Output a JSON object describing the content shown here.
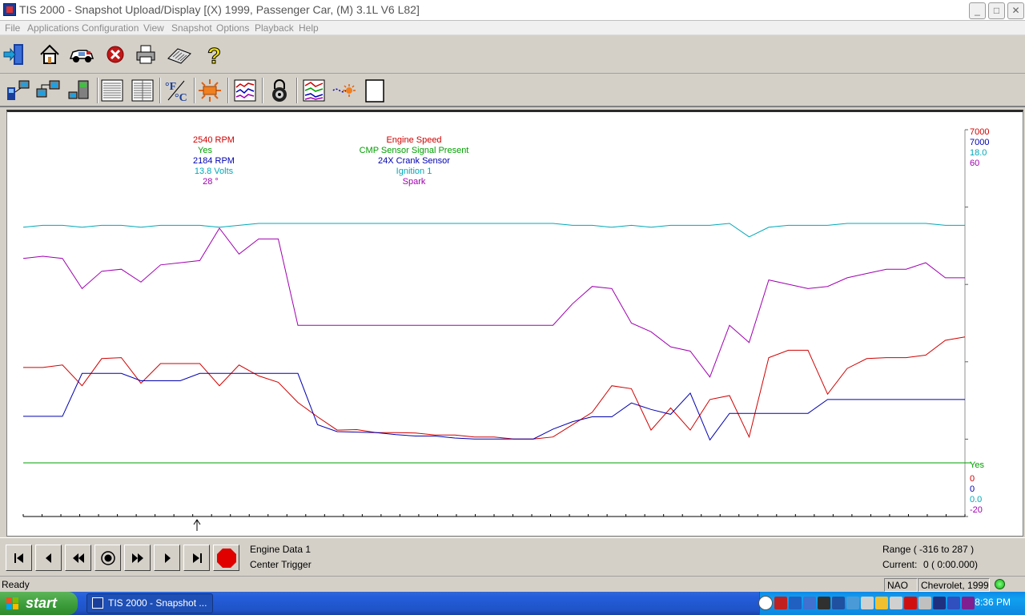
{
  "window": {
    "title": "TIS 2000 - Snapshot Upload/Display [(X) 1999, Passenger Car, (M) 3.1L   V6 L82]",
    "minimize": "_",
    "maximize": "□",
    "close": "✕"
  },
  "menu": [
    "File",
    "Applications",
    "Configuration",
    "View",
    "Snapshot",
    "Options",
    "Playback",
    "Help"
  ],
  "graph": {
    "values": [
      "2540 RPM",
      "Yes",
      "2184 RPM",
      "13.8 Volts",
      "28 °"
    ],
    "names": [
      "Engine Speed",
      "CMP Sensor Signal Present",
      "24X Crank Sensor",
      "Ignition 1",
      "Spark"
    ],
    "scale_max": [
      "7000",
      "7000",
      "18.0",
      "60"
    ],
    "scale_min": [
      "Yes",
      "0",
      "0",
      "0.0",
      "-20"
    ]
  },
  "chart_data": {
    "type": "line",
    "colors": {
      "engine_speed": "#d00000",
      "cmp": "#00a000",
      "crank": "#0000b0",
      "ignition": "#00a8b8",
      "spark": "#a000b0"
    },
    "series": [
      {
        "name": "Engine Speed",
        "ylim": [
          0,
          7000
        ],
        "values": [
          2600,
          2600,
          2650,
          2230,
          2780,
          2800,
          2280,
          2680,
          2680,
          2680,
          2230,
          2650,
          2430,
          2300,
          1890,
          1600,
          1330,
          1340,
          1280,
          1280,
          1270,
          1230,
          1230,
          1190,
          1190,
          1150,
          1150,
          1190,
          1440,
          1690,
          2230,
          2170,
          1330,
          1780,
          1330,
          1950,
          2030,
          1190,
          2800,
          2950,
          2950,
          2060,
          2580,
          2780,
          2800,
          2800,
          2850,
          3150,
          3220
        ]
      },
      {
        "name": "CMP Sensor Signal Present",
        "values": [
          "Yes"
        ]
      },
      {
        "name": "24X Crank Sensor",
        "ylim": [
          0,
          7000
        ],
        "values": [
          1610,
          1610,
          1610,
          2480,
          2480,
          2480,
          2330,
          2330,
          2330,
          2480,
          2480,
          2480,
          2480,
          2480,
          2480,
          1440,
          1300,
          1290,
          1280,
          1240,
          1210,
          1210,
          1170,
          1150,
          1150,
          1150,
          1150,
          1350,
          1500,
          1600,
          1600,
          1880,
          1750,
          1650,
          2080,
          1130,
          1670,
          1670,
          1670,
          1670,
          1670,
          1950,
          1950,
          1950,
          1950,
          1950,
          1950,
          1950,
          1950
        ]
      },
      {
        "name": "Ignition 1",
        "ylim": [
          0.0,
          18.0
        ],
        "values": [
          14.0,
          14.1,
          14.1,
          14.0,
          14.1,
          14.1,
          14.0,
          14.1,
          14.1,
          14.1,
          14.0,
          14.1,
          14.2,
          14.2,
          14.2,
          14.2,
          14.2,
          14.2,
          14.2,
          14.2,
          14.2,
          14.2,
          14.2,
          14.2,
          14.2,
          14.2,
          14.2,
          14.2,
          14.1,
          14.1,
          14.0,
          14.1,
          14.0,
          14.1,
          14.1,
          14.1,
          14.2,
          13.5,
          14.0,
          14.1,
          14.1,
          14.1,
          14.2,
          14.2,
          14.2,
          14.2,
          14.2,
          14.1,
          14.1
        ]
      },
      {
        "name": "Spark",
        "ylim": [
          -20,
          60
        ],
        "values": [
          35,
          35.5,
          35,
          28,
          32,
          32.5,
          29.5,
          33.5,
          34,
          34.5,
          42,
          36,
          39.5,
          39.5,
          19.5,
          19.5,
          19.5,
          19.5,
          19.5,
          19.5,
          19.5,
          19.5,
          19.5,
          19.5,
          19.5,
          19.5,
          19.5,
          19.5,
          24.5,
          28.5,
          28,
          20,
          18,
          14.5,
          13.5,
          7.5,
          19.5,
          15.5,
          30,
          29,
          28,
          28.5,
          30.5,
          31.5,
          32.5,
          32.5,
          34,
          30.5,
          30.5
        ]
      }
    ],
    "xlim": [
      -316,
      287
    ],
    "marker_x": 0
  },
  "playback": {
    "buttons": [
      "first",
      "prev",
      "rewind",
      "record",
      "fast-forward",
      "next",
      "last",
      "stop"
    ],
    "data_name": "Engine Data 1",
    "trigger": "Center Trigger",
    "range": "Range ( -316 to 287 )",
    "current_label": "Current:",
    "current_value": "0 ( 0:00.000)"
  },
  "status": {
    "text": "Ready",
    "region": "NAO",
    "vehicle": "Chevrolet, 1999"
  },
  "taskbar": {
    "start": "start",
    "task": "TIS 2000 - Snapshot ...",
    "clock": "8:36 PM"
  }
}
